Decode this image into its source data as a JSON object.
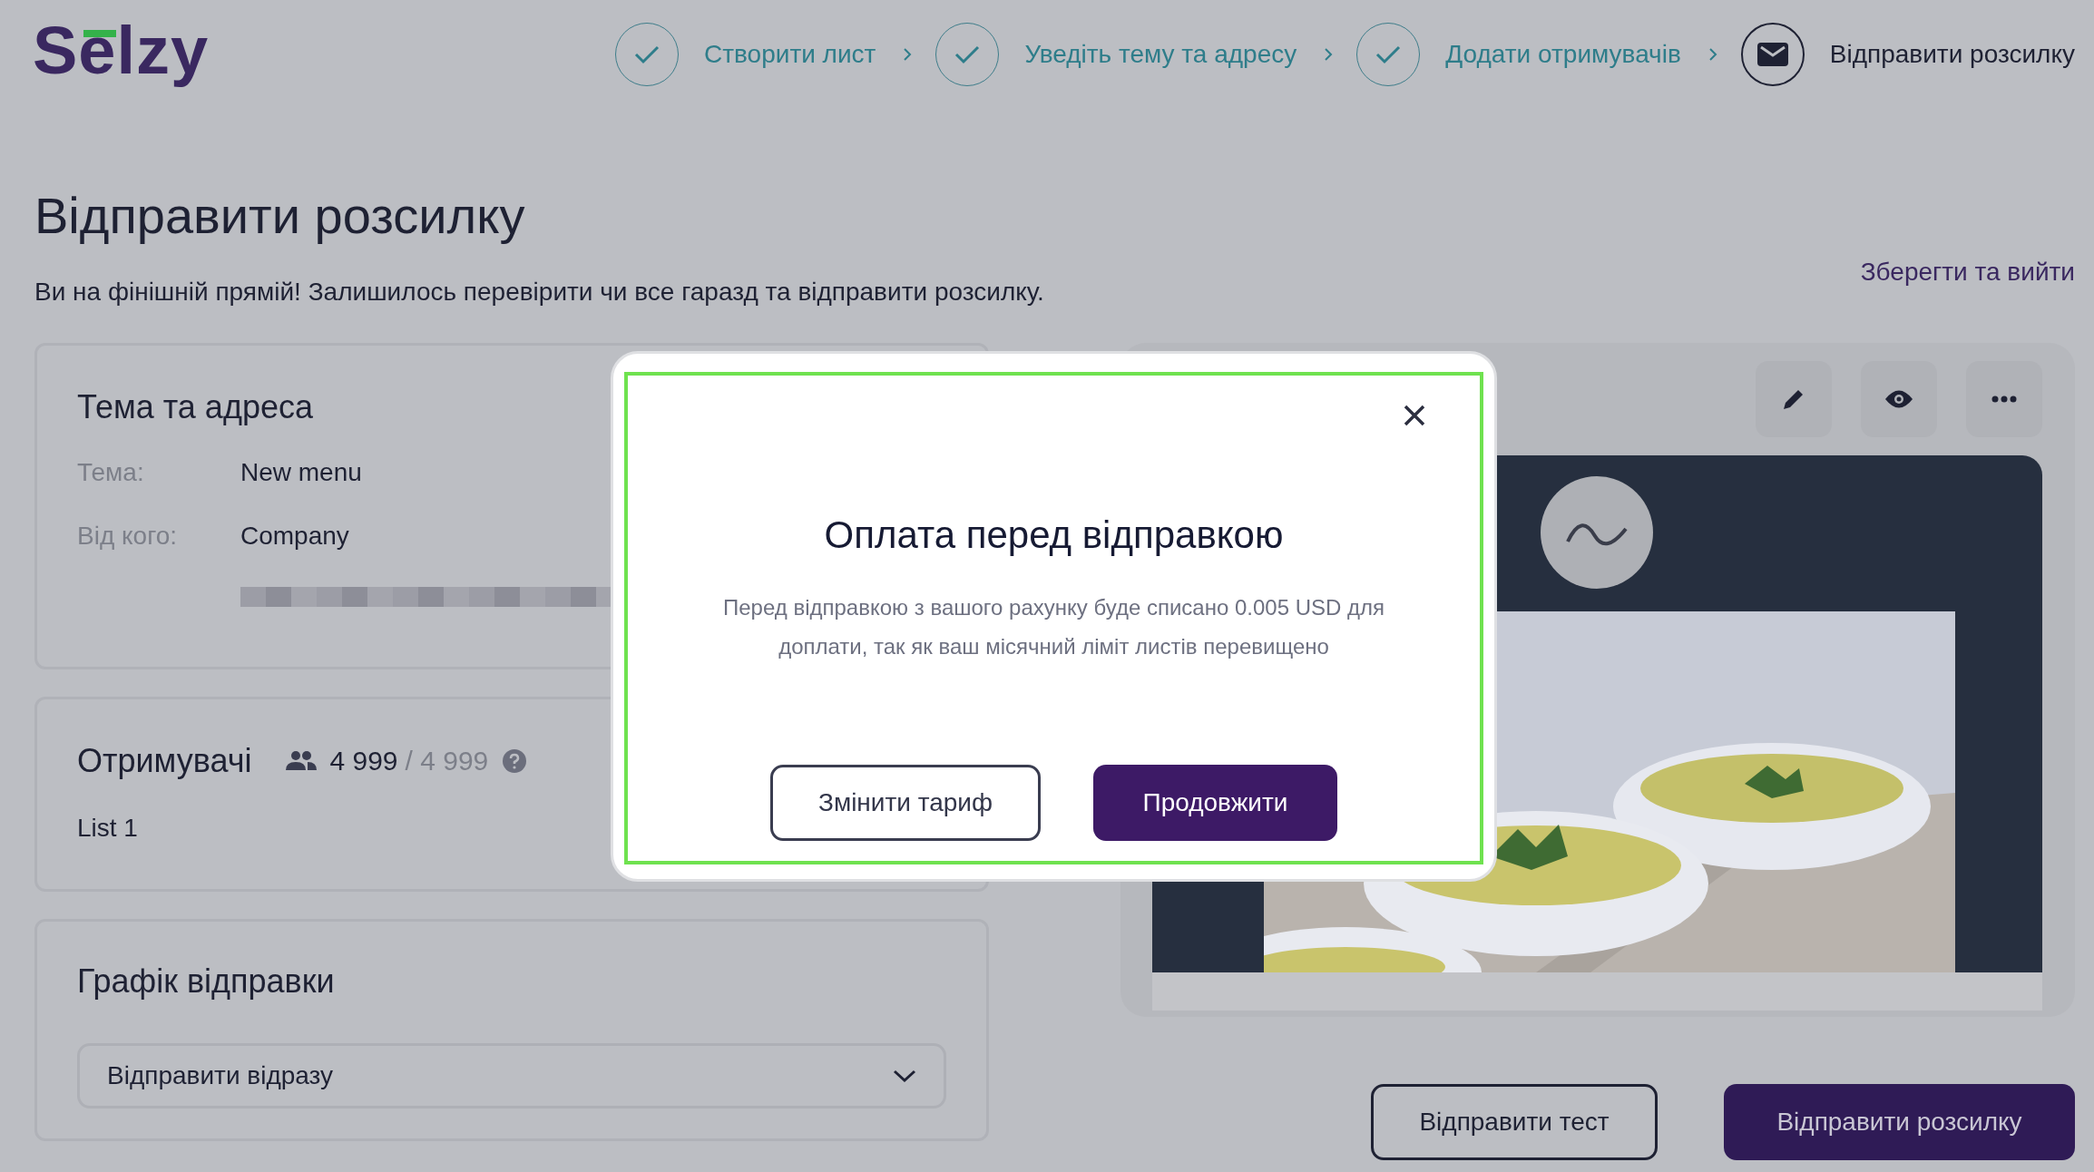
{
  "header": {
    "logo": "Selzy",
    "steps": [
      {
        "label": "Створити лист",
        "done": true
      },
      {
        "label": "Уведіть тему та адресу",
        "done": true
      },
      {
        "label": "Додати отримувачів",
        "done": true
      },
      {
        "label": "Відправити розсилку",
        "done": false
      }
    ]
  },
  "page": {
    "title": "Відправити розсилку",
    "subtitle": "Ви на фінішній прямій! Залишилось перевірити чи все гаразд та відправити розсилку.",
    "save_exit": "Зберегти та вийти"
  },
  "subject_card": {
    "title": "Тема та адреса",
    "fields": [
      {
        "label": "Тема:",
        "value": "New menu"
      },
      {
        "label": "Від кого:",
        "value": "Company"
      }
    ]
  },
  "recipients_card": {
    "title": "Отримувачі",
    "count": "4 999",
    "limit": "/ 4 999",
    "lists": [
      "List 1"
    ]
  },
  "schedule_card": {
    "title": "Графік відправки",
    "select": {
      "value": "Відправити відразу"
    }
  },
  "actions": [
    {
      "label": "Відправити тест",
      "kind": "secondary"
    },
    {
      "label": "Відправити розсилку",
      "kind": "primary"
    }
  ],
  "dialog": {
    "title": "Оплата перед відправкою",
    "message": "Перед відправкою з вашого рахунку буде списано 0.005 USD для доплати, так як ваш місячний ліміт листів перевищено",
    "buttons": [
      {
        "label": "Змінити тариф",
        "kind": "secondary"
      },
      {
        "label": "Продовжити",
        "kind": "primary"
      }
    ]
  }
}
